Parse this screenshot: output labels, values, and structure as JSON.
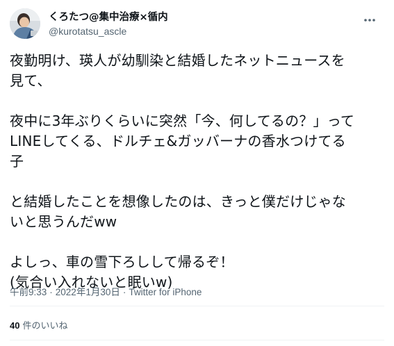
{
  "author": {
    "display_name": "くろたつ@集中治療×循内",
    "handle": "@kurotatsu_ascle"
  },
  "tweet": {
    "text": "夜勤明け、瑛人が幼馴染と結婚したネットニュースを\n見て、\n\n夜中に3年ぶりくらいに突然「今、何してるの？」って\nLINEしてくる、ドルチェ&ガッバーナの香水つけてる\n子\n\nと結婚したことを想像したのは、きっと僕だけじゃな\nいと思うんだww\n\nよしっ、車の雪下ろしして帰るぞ！\n(気合い入れないと眠いw)",
    "time": "午前9:33",
    "date": "2022年1月30日",
    "separator": "·",
    "source": "Twitter for iPhone"
  },
  "stats": {
    "likes_count": "40",
    "likes_label": "件のいいね"
  },
  "icons": {
    "avatar": "avatar-photo",
    "more": "more-options-icon"
  },
  "colors": {
    "text_primary": "#0f1419",
    "text_secondary": "#536471",
    "divider": "#eff3f4"
  }
}
